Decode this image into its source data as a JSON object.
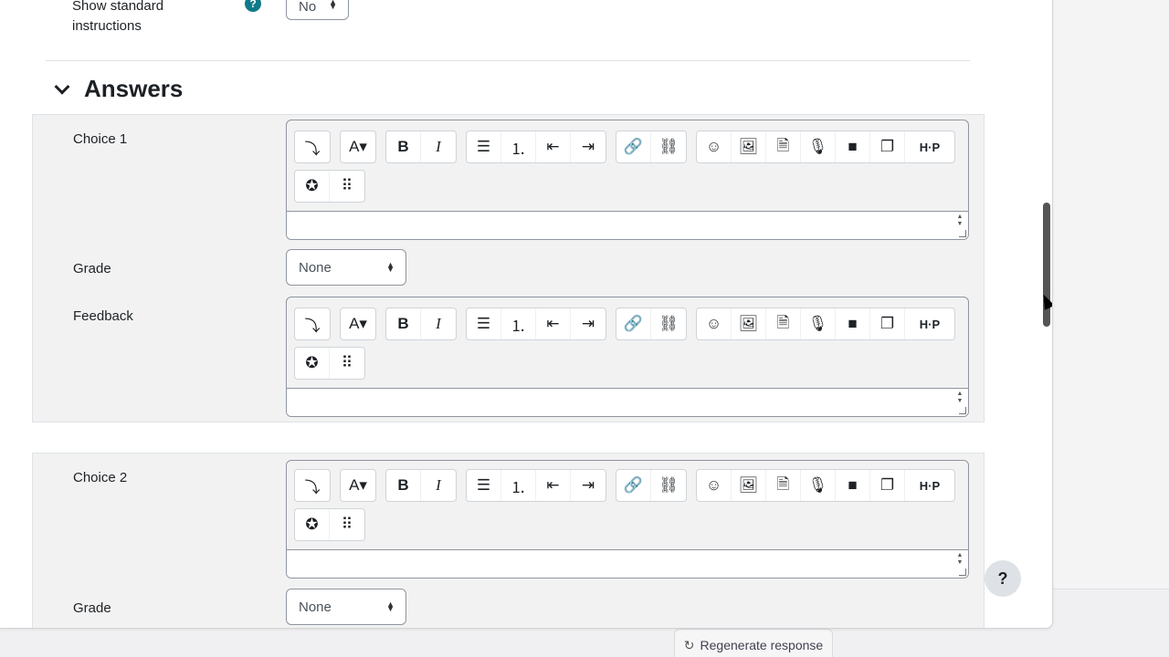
{
  "top_field": {
    "label": "Show standard instructions",
    "help_icon": "?",
    "value": "No"
  },
  "section": {
    "title": "Answers"
  },
  "choices": [
    {
      "choice_label": "Choice 1",
      "grade_label": "Grade",
      "grade_value": "None",
      "feedback_label": "Feedback"
    },
    {
      "choice_label": "Choice 2",
      "grade_label": "Grade",
      "grade_value": "None"
    }
  ],
  "toolbar": {
    "groups": [
      [
        "collapse-icon"
      ],
      [
        "font-style-icon"
      ],
      [
        "bold-icon",
        "italic-icon"
      ],
      [
        "bullet-list-icon",
        "numbered-list-icon",
        "outdent-icon",
        "indent-icon"
      ],
      [
        "link-icon",
        "unlink-icon"
      ],
      [
        "emoji-icon",
        "image-icon",
        "media-file-icon",
        "record-audio-icon",
        "record-video-icon",
        "manage-files-icon",
        "h5p-icon"
      ]
    ],
    "row2": [
      "accessibility-icon",
      "screen-reader-icon"
    ],
    "glyphs": {
      "collapse-icon": "⤵",
      "font-style-icon": "A▾",
      "bold-icon": "B",
      "italic-icon": "I",
      "bullet-list-icon": "☰",
      "numbered-list-icon": "⒈",
      "outdent-icon": "⇤",
      "indent-icon": "⇥",
      "link-icon": "🔗",
      "unlink-icon": "⛓",
      "emoji-icon": "☺",
      "image-icon": "🖼",
      "media-file-icon": "🗎",
      "record-audio-icon": "🎙",
      "record-video-icon": "■",
      "manage-files-icon": "❐",
      "h5p-icon": "H·P",
      "accessibility-icon": "✪",
      "screen-reader-icon": "⠿"
    }
  },
  "help_button": "?",
  "regenerate_button": {
    "label": "Regenerate response",
    "icon": "↻"
  }
}
